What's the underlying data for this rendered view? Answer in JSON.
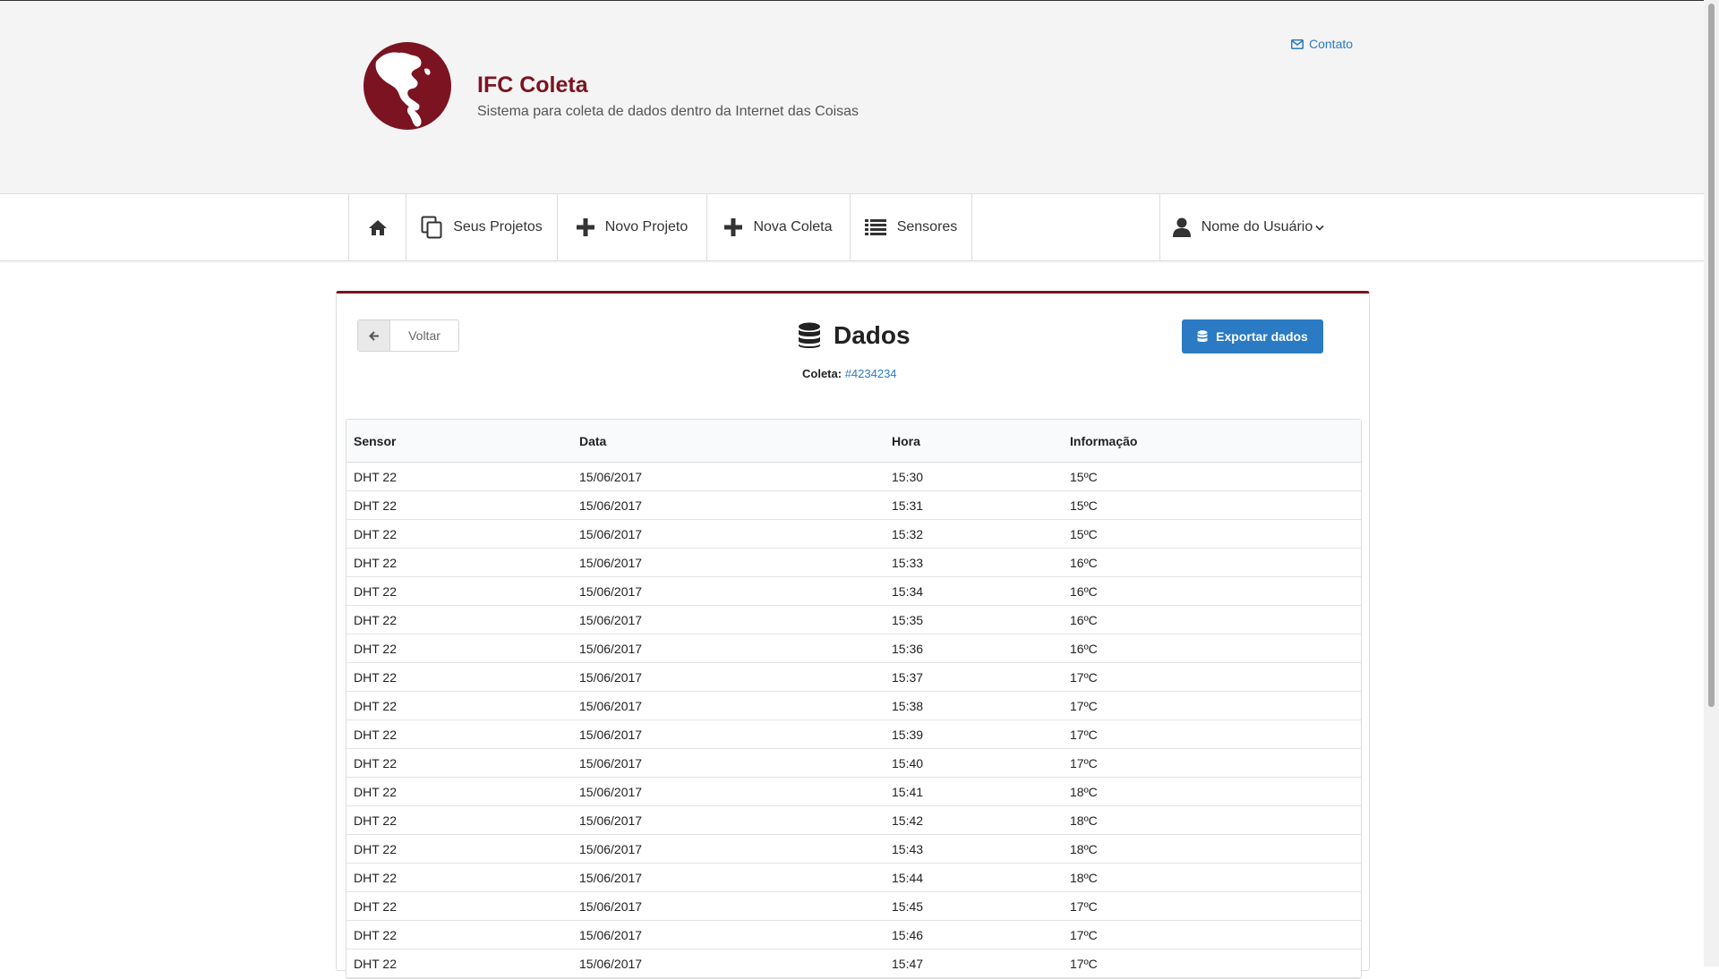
{
  "brand": {
    "title": "IFC Coleta",
    "subtitle": "Sistema para coleta de dados dentro da Internet das Coisas",
    "color": "#7b1420"
  },
  "header": {
    "contact_label": "Contato"
  },
  "nav": {
    "home_icon": "home-icon",
    "items": [
      {
        "label": "Seus Projetos",
        "icon": "copy-icon"
      },
      {
        "label": "Novo Projeto",
        "icon": "plus-icon"
      },
      {
        "label": "Nova Coleta",
        "icon": "plus-icon"
      },
      {
        "label": "Sensores",
        "icon": "list-icon"
      }
    ],
    "user_label": "Nome do Usuário"
  },
  "page": {
    "back_label": "Voltar",
    "title": "Dados",
    "coleta_label": "Coleta:",
    "coleta_id": "#4234234",
    "export_label": "Exportar dados",
    "accent": "#2b7bc4"
  },
  "table": {
    "columns": [
      "Sensor",
      "Data",
      "Hora",
      "Informação"
    ],
    "rows": [
      [
        "DHT 22",
        "15/06/2017",
        "15:30",
        "15ºC"
      ],
      [
        "DHT 22",
        "15/06/2017",
        "15:31",
        "15ºC"
      ],
      [
        "DHT 22",
        "15/06/2017",
        "15:32",
        "15ºC"
      ],
      [
        "DHT 22",
        "15/06/2017",
        "15:33",
        "16ºC"
      ],
      [
        "DHT 22",
        "15/06/2017",
        "15:34",
        "16ºC"
      ],
      [
        "DHT 22",
        "15/06/2017",
        "15:35",
        "16ºC"
      ],
      [
        "DHT 22",
        "15/06/2017",
        "15:36",
        "16ºC"
      ],
      [
        "DHT 22",
        "15/06/2017",
        "15:37",
        "17ºC"
      ],
      [
        "DHT 22",
        "15/06/2017",
        "15:38",
        "17ºC"
      ],
      [
        "DHT 22",
        "15/06/2017",
        "15:39",
        "17ºC"
      ],
      [
        "DHT 22",
        "15/06/2017",
        "15:40",
        "17ºC"
      ],
      [
        "DHT 22",
        "15/06/2017",
        "15:41",
        "18ºC"
      ],
      [
        "DHT 22",
        "15/06/2017",
        "15:42",
        "18ºC"
      ],
      [
        "DHT 22",
        "15/06/2017",
        "15:43",
        "18ºC"
      ],
      [
        "DHT 22",
        "15/06/2017",
        "15:44",
        "18ºC"
      ],
      [
        "DHT 22",
        "15/06/2017",
        "15:45",
        "17ºC"
      ],
      [
        "DHT 22",
        "15/06/2017",
        "15:46",
        "17ºC"
      ],
      [
        "DHT 22",
        "15/06/2017",
        "15:47",
        "17ºC"
      ]
    ]
  }
}
